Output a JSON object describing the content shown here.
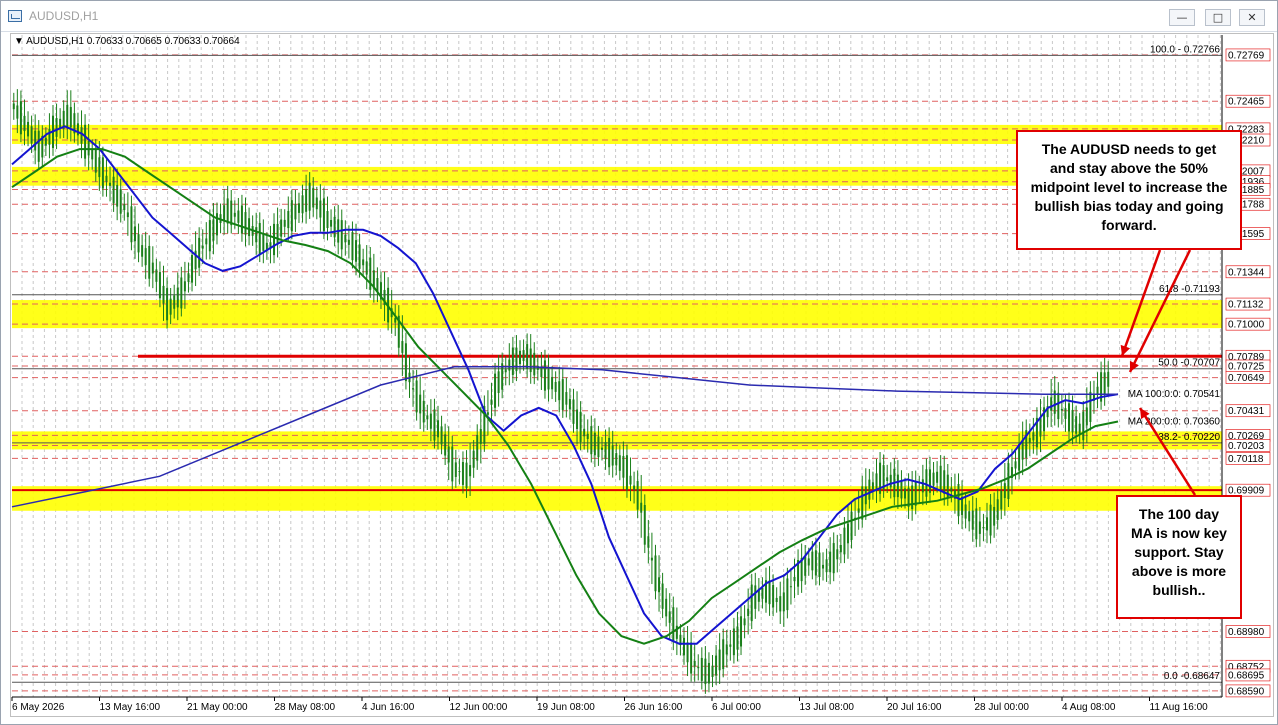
{
  "window": {
    "title": "AUDUSD,H1",
    "buttons": [
      {
        "glyph": "—"
      },
      {
        "glyph": "□"
      },
      {
        "glyph": "✕"
      }
    ]
  },
  "chart_info": {
    "symbol": "AUDUSD,H1",
    "ohlc": "0.70633 0.70665 0.70633 0.70664"
  },
  "colors": {
    "candle": "#1a7f1a",
    "ma100": "#1414d0",
    "ma200": "#148014",
    "ma_daily": "#2a2ab0",
    "zones": "#ffff00",
    "levels": "#e00000",
    "notes_border": "#e00000"
  },
  "notes": [
    {
      "text": "The AUDUSD needs to get and stay above the 50% midpoint level to increase the bullish bias today and going forward."
    },
    {
      "text": "The 100 day MA is now key support. Stay above is more bullish.."
    }
  ],
  "chart_data": {
    "type": "line",
    "title": "",
    "xlabel": "",
    "ylabel": "",
    "ylim": [
      0.6855,
      0.729
    ],
    "x_ticks": [
      "6 May 2026",
      "13 May 16:00",
      "21 May 00:00",
      "28 May 08:00",
      "4 Jun 16:00",
      "12 Jun 00:00",
      "19 Jun 08:00",
      "26 Jun 16:00",
      "6 Jul 00:00",
      "13 Jul 08:00",
      "20 Jul 16:00",
      "28 Jul 00:00",
      "4 Aug 08:00",
      "11 Aug 16:00"
    ],
    "y_tick_labels": [
      {
        "label": "0.72769",
        "value": 0.72769
      },
      {
        "label": "0.72465",
        "value": 0.72465
      },
      {
        "label": "0.72283",
        "value": 0.72283
      },
      {
        "label": "0.72210",
        "value": 0.7221
      },
      {
        "label": "0.72007",
        "value": 0.72007
      },
      {
        "label": "0.71936",
        "value": 0.71936
      },
      {
        "label": "0.71885",
        "value": 0.71885
      },
      {
        "label": "0.71788",
        "value": 0.71788
      },
      {
        "label": "0.71595",
        "value": 0.71595
      },
      {
        "label": "0.71344",
        "value": 0.71344
      },
      {
        "label": "0.71132",
        "value": 0.71132
      },
      {
        "label": "0.71000",
        "value": 0.71
      },
      {
        "label": "0.70789",
        "value": 0.70789
      },
      {
        "label": "0.70725",
        "value": 0.70725
      },
      {
        "label": "0.70649",
        "value": 0.70649
      },
      {
        "label": "0.70431",
        "value": 0.70431
      },
      {
        "label": "0.70269",
        "value": 0.70269
      },
      {
        "label": "0.70203",
        "value": 0.70203
      },
      {
        "label": "0.70118",
        "value": 0.70118
      },
      {
        "label": "0.69909",
        "value": 0.69909
      },
      {
        "label": "0.68980",
        "value": 0.6898
      },
      {
        "label": "0.68752",
        "value": 0.68752
      },
      {
        "label": "0.68695",
        "value": 0.68695
      },
      {
        "label": "0.68590",
        "value": 0.6859
      }
    ],
    "fib_levels": [
      {
        "label": "100.0 - 0.72766",
        "value": 0.72766
      },
      {
        "label": "61.8 -0.71193",
        "value": 0.71193
      },
      {
        "label": "50.0 -0.70707",
        "value": 0.70707
      },
      {
        "label": "38.2- 0.70220",
        "value": 0.7022
      },
      {
        "label": "0.0 -0.68647",
        "value": 0.68647
      }
    ],
    "ma_labels": [
      {
        "label": "MA 100:0:0: 0.70541",
        "value": 0.70541
      },
      {
        "label": "MA 200:0:0: 0.70360",
        "value": 0.7036
      }
    ],
    "zones": [
      {
        "from": 0.7221,
        "to": 0.72283
      },
      {
        "from": 0.71936,
        "to": 0.72007
      },
      {
        "from": 0.71,
        "to": 0.71132
      },
      {
        "from": 0.70203,
        "to": 0.70269
      },
      {
        "from": 0.698,
        "to": 0.69909
      }
    ],
    "level_lines": [
      0.70789,
      0.69909
    ],
    "series": [
      {
        "name": "price",
        "values": [
          0.7245,
          0.723,
          0.7215,
          0.7228,
          0.7238,
          0.7222,
          0.7205,
          0.719,
          0.7175,
          0.715,
          0.7135,
          0.711,
          0.7122,
          0.7145,
          0.716,
          0.7175,
          0.717,
          0.716,
          0.715,
          0.7165,
          0.7175,
          0.7185,
          0.717,
          0.716,
          0.715,
          0.7135,
          0.712,
          0.71,
          0.706,
          0.704,
          0.703,
          0.7005,
          0.7,
          0.703,
          0.706,
          0.7075,
          0.708,
          0.707,
          0.706,
          0.705,
          0.703,
          0.702,
          0.7015,
          0.7005,
          0.6985,
          0.694,
          0.691,
          0.689,
          0.6875,
          0.687,
          0.6885,
          0.6895,
          0.692,
          0.6925,
          0.6915,
          0.6935,
          0.6945,
          0.694,
          0.695,
          0.697,
          0.699,
          0.7,
          0.6995,
          0.6985,
          0.6995,
          0.7,
          0.699,
          0.6975,
          0.6965,
          0.6975,
          0.7,
          0.702,
          0.703,
          0.705,
          0.704,
          0.703,
          0.7055,
          0.7065
        ]
      },
      {
        "name": "MA 100",
        "values": [
          0.7205,
          0.7215,
          0.7225,
          0.723,
          0.7225,
          0.7215,
          0.72,
          0.7185,
          0.717,
          0.716,
          0.715,
          0.714,
          0.7135,
          0.7138,
          0.7145,
          0.7152,
          0.7158,
          0.716,
          0.716,
          0.7162,
          0.7162,
          0.7158,
          0.715,
          0.714,
          0.712,
          0.7095,
          0.707,
          0.704,
          0.703,
          0.704,
          0.7045,
          0.704,
          0.702,
          0.6995,
          0.696,
          0.6935,
          0.691,
          0.6895,
          0.689,
          0.689,
          0.69,
          0.691,
          0.692,
          0.693,
          0.6935,
          0.6945,
          0.696,
          0.6975,
          0.6985,
          0.699,
          0.6995,
          0.6998,
          0.6995,
          0.699,
          0.6985,
          0.699,
          0.7005,
          0.7015,
          0.703,
          0.7045,
          0.705,
          0.7048,
          0.7052,
          0.7054
        ]
      },
      {
        "name": "MA 200",
        "values": [
          0.719,
          0.72,
          0.721,
          0.7215,
          0.7215,
          0.721,
          0.72,
          0.719,
          0.718,
          0.717,
          0.7165,
          0.716,
          0.7155,
          0.7152,
          0.7148,
          0.714,
          0.7125,
          0.7105,
          0.7085,
          0.707,
          0.7055,
          0.704,
          0.702,
          0.6995,
          0.6965,
          0.6935,
          0.691,
          0.6895,
          0.689,
          0.6895,
          0.6905,
          0.692,
          0.693,
          0.694,
          0.695,
          0.6958,
          0.6965,
          0.697,
          0.6975,
          0.698,
          0.6982,
          0.6984,
          0.6988,
          0.6992,
          0.6998,
          0.7005,
          0.7015,
          0.7025,
          0.7033,
          0.7036
        ]
      },
      {
        "name": "daily MA",
        "values": [
          0.698,
          0.699,
          0.7,
          0.702,
          0.704,
          0.706,
          0.7072,
          0.7072,
          0.707,
          0.7065,
          0.706,
          0.7058,
          0.7056,
          0.7055,
          0.7054,
          0.7054
        ]
      }
    ]
  }
}
